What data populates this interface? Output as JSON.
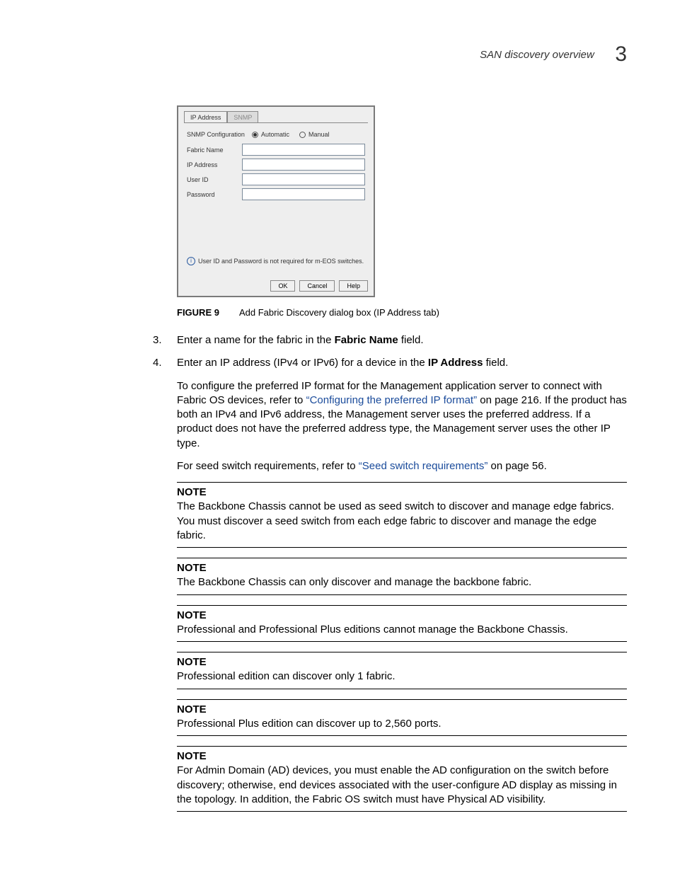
{
  "header": {
    "title": "SAN discovery overview",
    "chapter": "3"
  },
  "dialog": {
    "tabs": [
      "IP Address",
      "SNMP"
    ],
    "conf_label": "SNMP Configuration",
    "radio_auto": "Automatic",
    "radio_manual": "Manual",
    "fields": {
      "fabric_name": "Fabric Name",
      "ip_address": "IP Address",
      "user_id": "User ID",
      "password": "Password"
    },
    "info": "User ID and Password is not required for m-EOS switches.",
    "buttons": {
      "ok": "OK",
      "cancel": "Cancel",
      "help": "Help"
    }
  },
  "figure": {
    "num": "FIGURE 9",
    "caption": "Add Fabric Discovery dialog box (IP Address tab)"
  },
  "step3": {
    "pre": "Enter a name for the fabric in the ",
    "bold": "Fabric Name",
    "post": " field."
  },
  "step4": {
    "line1_pre": "Enter an IP address (IPv4 or IPv6) for a device in the ",
    "line1_bold": "IP Address",
    "line1_post": " field.",
    "para2_pre": "To configure the preferred IP format for the Management application server to connect with Fabric OS devices, refer to ",
    "para2_link": "“Configuring the preferred IP format”",
    "para2_post": " on page 216. If the product has both an IPv4 and IPv6 address, the Management server uses the preferred address. If a product does not have the preferred address type, the Management server uses the other IP type.",
    "para3_pre": "For seed switch requirements, refer to ",
    "para3_link": "“Seed switch requirements”",
    "para3_post": " on page 56."
  },
  "notes": [
    {
      "hd": "NOTE",
      "body": "The Backbone Chassis cannot be used as seed switch to discover and manage edge fabrics. You must discover a seed switch from each edge fabric to discover and manage the edge fabric."
    },
    {
      "hd": "NOTE",
      "body": "The Backbone Chassis can only discover and manage the backbone fabric."
    },
    {
      "hd": "NOTE",
      "body": "Professional and Professional Plus editions cannot manage the Backbone Chassis."
    },
    {
      "hd": "NOTE",
      "body": "Professional edition can discover only 1 fabric."
    },
    {
      "hd": "NOTE",
      "body": "Professional Plus edition can discover up to 2,560 ports."
    },
    {
      "hd": "NOTE",
      "body": "For Admin Domain (AD) devices, you must enable the AD configuration on the switch before discovery; otherwise, end devices associated with the user-configure AD display as missing in the topology. In addition, the Fabric OS switch must have Physical AD visibility."
    }
  ]
}
